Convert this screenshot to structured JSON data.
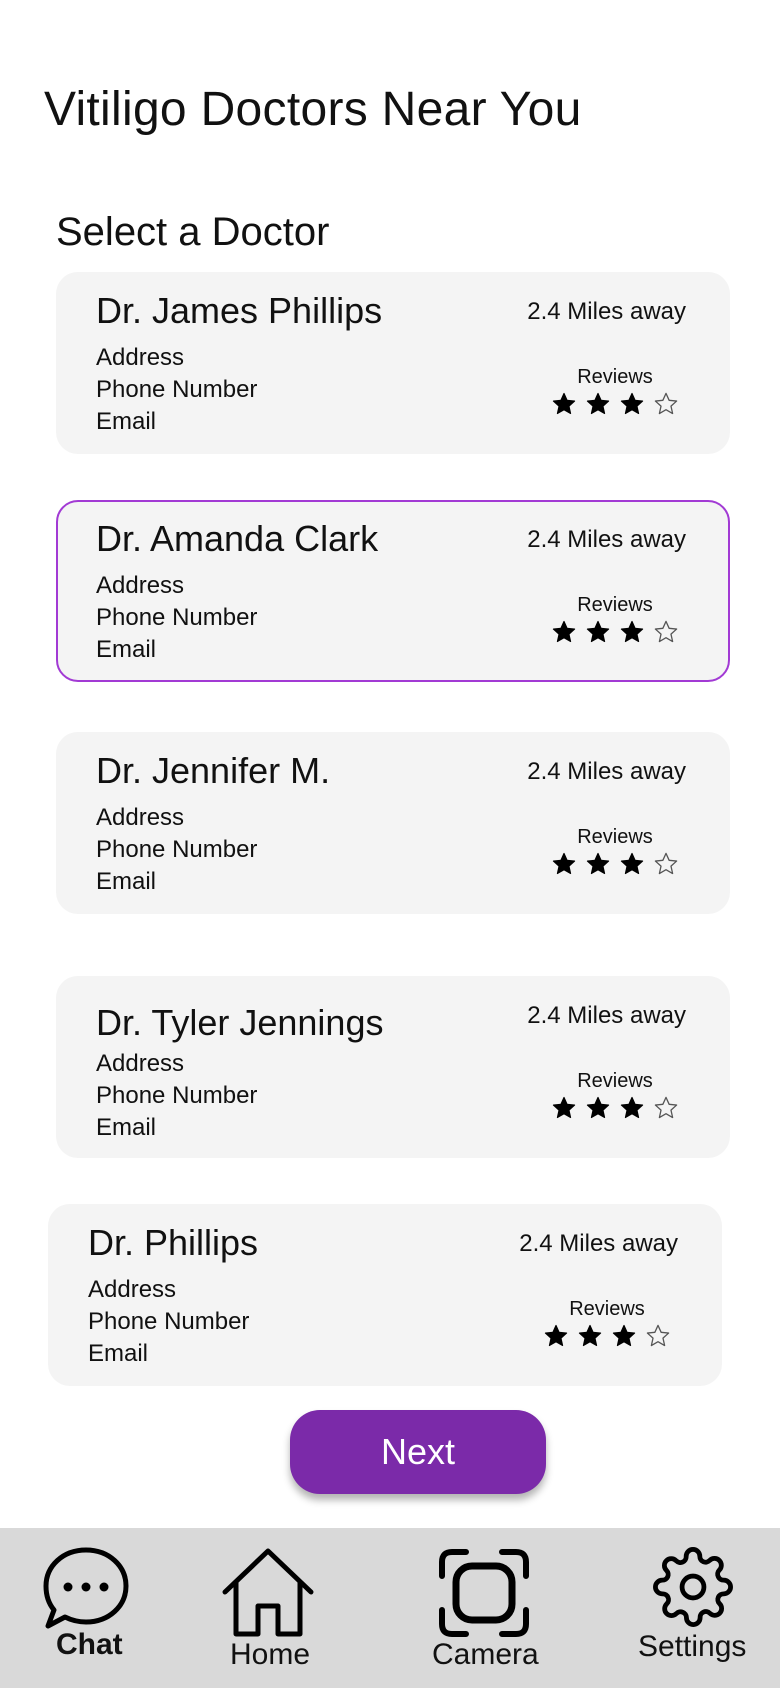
{
  "page": {
    "title": "Vitiligo Doctors Near You",
    "section_title": "Select a Doctor"
  },
  "doctors": [
    {
      "name": "Dr. James Phillips",
      "distance": "2.4 Miles away",
      "address_label": "Address",
      "phone_label": "Phone Number",
      "email_label": "Email",
      "reviews_label": "Reviews",
      "rating": 3,
      "rating_max": 4,
      "selected": false
    },
    {
      "name": "Dr. Amanda Clark",
      "distance": "2.4 Miles away",
      "address_label": "Address",
      "phone_label": "Phone Number",
      "email_label": "Email",
      "reviews_label": "Reviews",
      "rating": 3,
      "rating_max": 4,
      "selected": true
    },
    {
      "name": "Dr. Jennifer M.",
      "distance": "2.4 Miles away",
      "address_label": "Address",
      "phone_label": "Phone Number",
      "email_label": "Email",
      "reviews_label": "Reviews",
      "rating": 3,
      "rating_max": 4,
      "selected": false
    },
    {
      "name": "Dr. Tyler Jennings",
      "distance": "2.4 Miles away",
      "address_label": "Address",
      "phone_label": "Phone Number",
      "email_label": "Email",
      "reviews_label": "Reviews",
      "rating": 3,
      "rating_max": 4,
      "selected": false
    },
    {
      "name": "Dr. Phillips",
      "distance": "2.4 Miles away",
      "address_label": "Address",
      "phone_label": "Phone Number",
      "email_label": "Email",
      "reviews_label": "Reviews",
      "rating": 3,
      "rating_max": 4,
      "selected": false
    }
  ],
  "next_button": {
    "label": "Next"
  },
  "tabbar": {
    "chat": {
      "label": "Chat",
      "icon": "chat-bubble-icon",
      "active": true
    },
    "home": {
      "label": "Home",
      "icon": "home-icon"
    },
    "camera": {
      "label": "Camera",
      "icon": "camera-frame-icon"
    },
    "settings": {
      "label": "Settings",
      "icon": "gear-icon"
    }
  },
  "colors": {
    "accent": "#7b2aa9",
    "selected_border": "#a23ad4",
    "card_bg": "#f4f4f4",
    "tabbar_bg": "#d9d9d9"
  }
}
